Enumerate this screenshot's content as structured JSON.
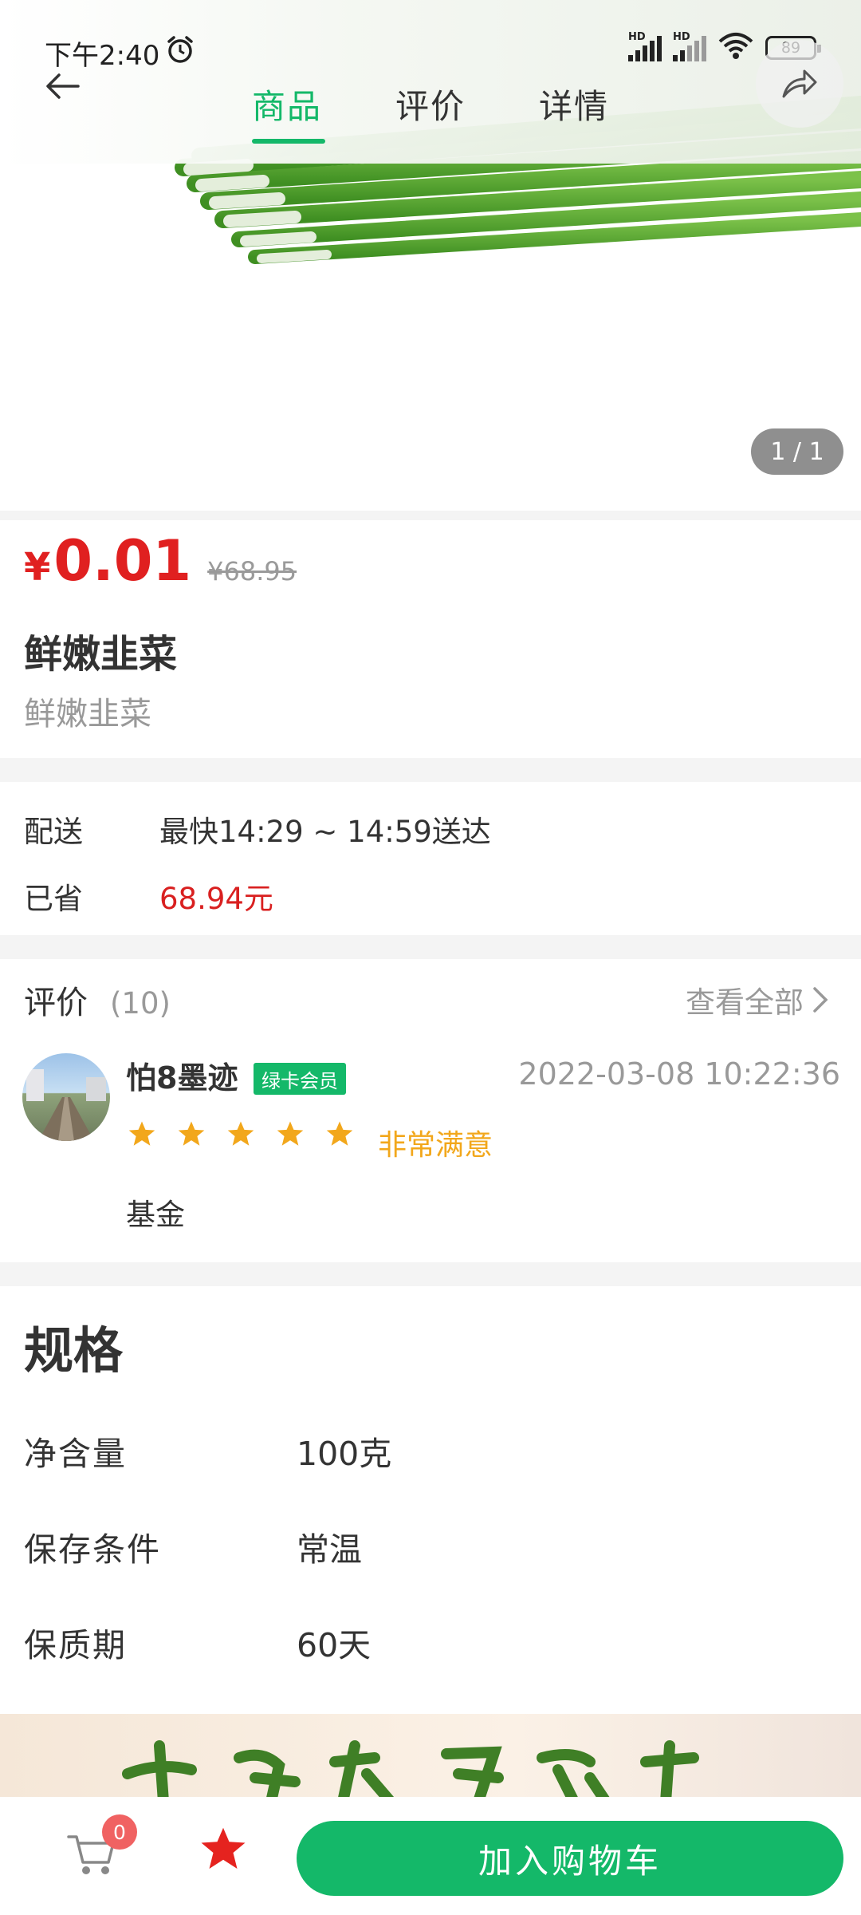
{
  "status_bar": {
    "time": "下午2:40",
    "hd1": "HD",
    "hd2": "HD",
    "battery": "89"
  },
  "nav": {
    "tabs": [
      "商品",
      "评价",
      "详情"
    ],
    "active_tab": "商品"
  },
  "gallery": {
    "counter": "1 / 1"
  },
  "product": {
    "price_symbol": "¥",
    "price": "0.01",
    "original_price": "¥68.95",
    "title": "鲜嫩韭菜",
    "subtitle": "鲜嫩韭菜"
  },
  "delivery": {
    "label": "配送",
    "value": "最快14:29 ~ 14:59送达",
    "saved_label": "已省",
    "saved_value": "68.94元"
  },
  "reviews": {
    "title": "评价",
    "count": "(10)",
    "view_all": "查看全部",
    "item": {
      "user": "怕8墨迹",
      "badge": "绿卡会员",
      "date": "2022-03-08 10:22:36",
      "rating": 5,
      "rating_text": "非常满意",
      "content": "基金"
    }
  },
  "spec": {
    "title": "规格",
    "rows": [
      {
        "k": "净含量",
        "v": "100克"
      },
      {
        "k": "保存条件",
        "v": "常温"
      },
      {
        "k": "保质期",
        "v": "60天"
      }
    ]
  },
  "bottom": {
    "cart_count": "0",
    "add_to_cart": "加入购物车"
  },
  "colors": {
    "brand_green": "#14b869",
    "price_red": "#e02020",
    "star_orange": "#f2a71b"
  }
}
